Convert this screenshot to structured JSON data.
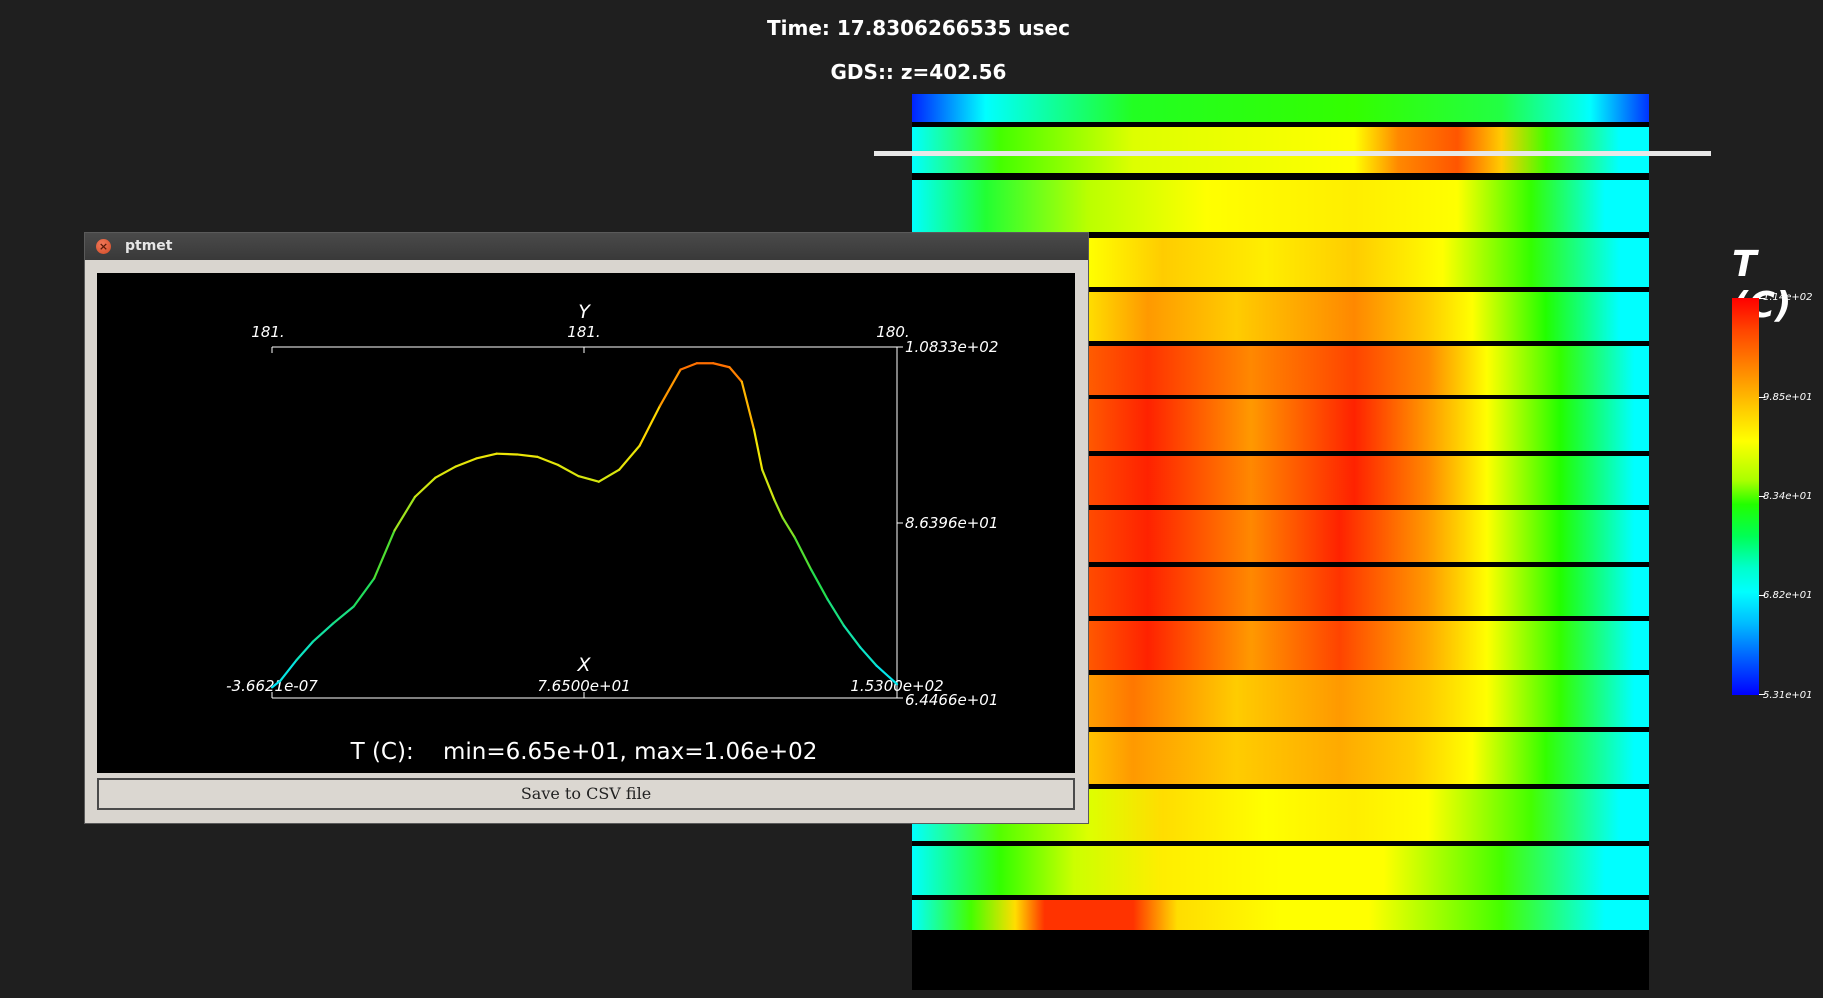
{
  "hud": {
    "time": "Time: 17.8306266535 usec",
    "gds": "GDS:: z=402.56"
  },
  "legend": {
    "title": "T (C)",
    "labels": [
      "1.14e+02",
      "9.85e+01",
      "8.34e+01",
      "6.82e+01",
      "5.31e+01"
    ]
  },
  "colors": {
    "background": "#1f1f1f",
    "plot_background": "#000000",
    "dialog_background": "#d9d5cf",
    "titlebar": "#3c3c3c"
  },
  "dialog": {
    "title": "ptmet",
    "close_icon": "close-icon",
    "save_button": "Save to CSV file"
  },
  "chart_data": {
    "type": "line",
    "summary": "T (C):    min=6.65e+01, max=1.06e+02",
    "xlabel": "X",
    "x_ticks": [
      "-3.6621e-07",
      "7.6500e+01",
      "1.5300e+02"
    ],
    "xlim": [
      0,
      153
    ],
    "y_axis_label": "Y",
    "top_ticks": [
      "181.",
      "181.",
      "180."
    ],
    "right_ticks": [
      "1.0833e+02",
      "8.6396e+01",
      "6.4466e+01"
    ],
    "ylim": [
      64.466,
      108.33
    ],
    "series": [
      {
        "x": [
          0,
          2,
          6,
          10,
          15,
          20,
          25,
          30,
          35,
          40,
          45,
          50,
          55,
          60,
          65,
          70,
          75,
          80,
          85,
          90,
          95,
          100,
          104,
          108,
          112,
          115,
          118,
          120,
          123,
          125,
          128,
          132,
          136,
          140,
          144,
          148,
          153
        ],
        "y": [
          65.8,
          66.6,
          69.2,
          71.5,
          73.8,
          75.9,
          79.4,
          85.4,
          89.6,
          92.0,
          93.4,
          94.4,
          95.0,
          94.9,
          94.6,
          93.6,
          92.2,
          91.5,
          93.0,
          96.0,
          101.0,
          105.5,
          106.3,
          106.3,
          105.8,
          104.0,
          98.0,
          93.0,
          89.2,
          87.0,
          84.5,
          80.5,
          76.8,
          73.5,
          70.8,
          68.5,
          66.2
        ]
      }
    ]
  }
}
